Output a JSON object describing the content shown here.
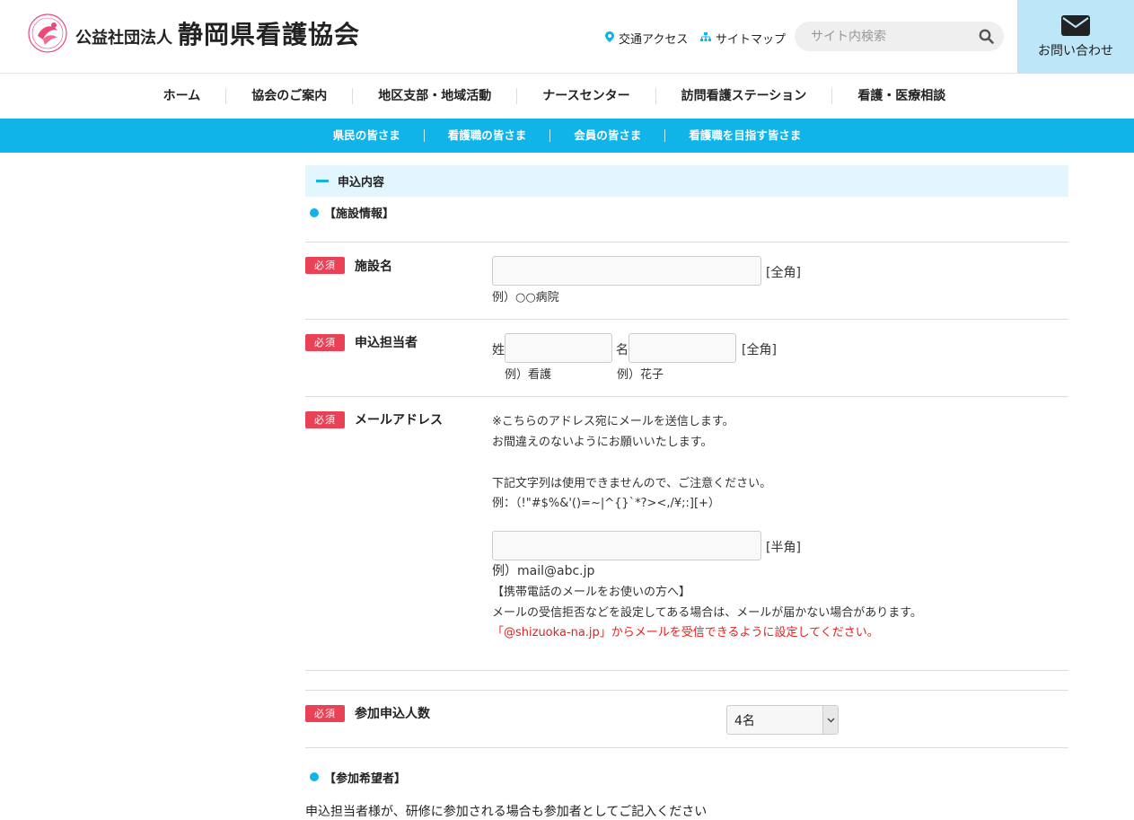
{
  "header": {
    "org_prefix": "公益社団法人",
    "org_name": "静岡県看護協会",
    "access_label": "交通アクセス",
    "sitemap_label": "サイトマップ",
    "search_placeholder": "サイト内検索",
    "contact_label": "お問い合わせ"
  },
  "main_nav": [
    "ホーム",
    "協会のご案内",
    "地区支部・地域活動",
    "ナースセンター",
    "訪問看護ステーション",
    "看護・医療相談"
  ],
  "sub_nav": [
    "県民の皆さま",
    "看護職の皆さま",
    "会員の皆さま",
    "看護職を目指す皆さま"
  ],
  "form": {
    "section_title": "申込内容",
    "facility_heading": "【施設情報】",
    "required_label": "必須",
    "facility": {
      "label": "施設名",
      "suffix": "[全角]",
      "example": "例）○○病院"
    },
    "applicant": {
      "label": "申込担当者",
      "last_name_prefix": "姓",
      "first_name_prefix": "名",
      "suffix": "[全角]",
      "last_example": "例）看護",
      "first_example": "例）花子"
    },
    "email": {
      "label": "メールアドレス",
      "note1": "※こちらのアドレス宛にメールを送信します。",
      "note2": "お間違えのないようにお願いいたします。",
      "note3": "下記文字列は使用できませんので、ご注意ください。",
      "note4": "例：（!\"#$%&'()=~|^{}`*?><,/¥;:][+）",
      "suffix": "[半角]",
      "example": "例）mail@abc.jp",
      "mobile_heading": "【携帯電話のメールをお使いの方へ】",
      "mobile_note": "メールの受信拒否などを設定してある場合は、メールが届かない場合があります。",
      "mobile_warning": "「@shizuoka-na.jp」からメールを受信できるように設定してください。"
    },
    "participants": {
      "label": "参加申込人数",
      "selected": "4名"
    },
    "participant_heading": "【参加希望者】",
    "participant_note": "申込担当者様が、研修に参加される場合も参加者としてご記入ください"
  },
  "colors": {
    "accent": "#10b4e8",
    "required": "#e94256",
    "warning": "#e61e1e"
  }
}
